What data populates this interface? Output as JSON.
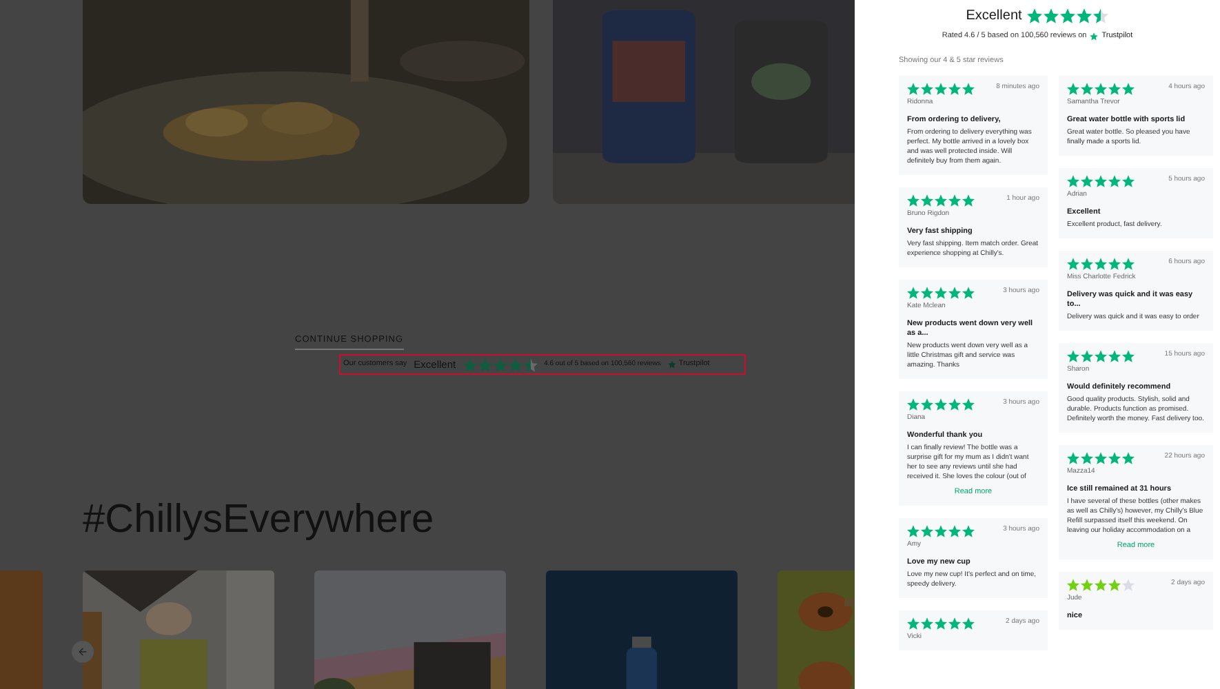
{
  "continue_shopping": "CONTINUE SHOPPING",
  "trust_bar": {
    "lead": "Our customers say",
    "rating_word": "Excellent",
    "stars": 4.5,
    "summary": "4.6 out of 5 based on 100,560 reviews",
    "brand": "Trustpilot"
  },
  "hashtag": "#ChillysEverywhere",
  "reviews_panel": {
    "title": "Excellent",
    "stars": 4.5,
    "rated": "Rated 4.6 / 5 based on 100,560 reviews on",
    "brand": "Trustpilot",
    "showing": "Showing our 4 & 5 star reviews",
    "columns": [
      {
        "reviews": [
          {
            "stars": 5,
            "time": "8 minutes ago",
            "author": "Ridonna",
            "title": "From ordering to delivery,",
            "body": "From ordering to delivery everything was perfect. My bottle arrived in a lovely box and was well protected inside. Will definitely buy from them again."
          },
          {
            "stars": 5,
            "time": "1 hour ago",
            "author": "Bruno Rigdon",
            "title": "Very fast shipping",
            "body": "Very fast shipping. Item match order. Great experience shopping at Chilly's."
          },
          {
            "stars": 5,
            "time": "3 hours ago",
            "author": "Kate Mclean",
            "title": "New products went down very well as a...",
            "body": "New products went down very well as a little Christmas gift and service was amazing. Thanks"
          },
          {
            "stars": 5,
            "time": "3 hours ago",
            "author": "Diana",
            "title": "Wonderful thank you",
            "body": "I can finally review! The bottle was a surprise gift for my mum as I didn't want her to see any reviews until she had received it. She loves the colour (out of",
            "read_more": "Read more"
          },
          {
            "stars": 5,
            "time": "3 hours ago",
            "author": "Amy",
            "title": "Love my new cup",
            "body": "Love my new cup! It's perfect and on time, speedy delivery."
          },
          {
            "stars": 5,
            "time": "2 days ago",
            "author": "Vicki"
          }
        ]
      },
      {
        "reviews": [
          {
            "stars": 5,
            "time": "4 hours ago",
            "author": "Samantha Trevor",
            "title": "Great water bottle with sports lid",
            "body": "Great water bottle. So pleased you have finally made a sports lid."
          },
          {
            "stars": 5,
            "time": "5 hours ago",
            "author": "Adrian",
            "title": "Excellent",
            "body": "Excellent product, fast delivery."
          },
          {
            "stars": 5,
            "time": "6 hours ago",
            "author": "Miss Charlotte Fedrick",
            "title": "Delivery was quick and it was easy to...",
            "body": "Delivery was quick and it was easy to order"
          },
          {
            "stars": 5,
            "time": "15 hours ago",
            "author": "Sharon",
            "title": "Would definitely recommend",
            "body": "Good quality products. Stylish, solid and durable. Products function as promised. Definitely worth the money. Fast delivery too."
          },
          {
            "stars": 5,
            "time": "22 hours ago",
            "author": "Mazza14",
            "title": "Ice still remained at 31 hours",
            "body": "I have several of these bottles (other makes as well as Chilly's) however, my Chilly's Blue Refill surpassed itself this weekend. On leaving our holiday accommodation on a",
            "read_more": "Read more"
          },
          {
            "stars": 4,
            "time": "2 days ago",
            "author": "Jude",
            "title": "nice"
          }
        ]
      }
    ]
  }
}
